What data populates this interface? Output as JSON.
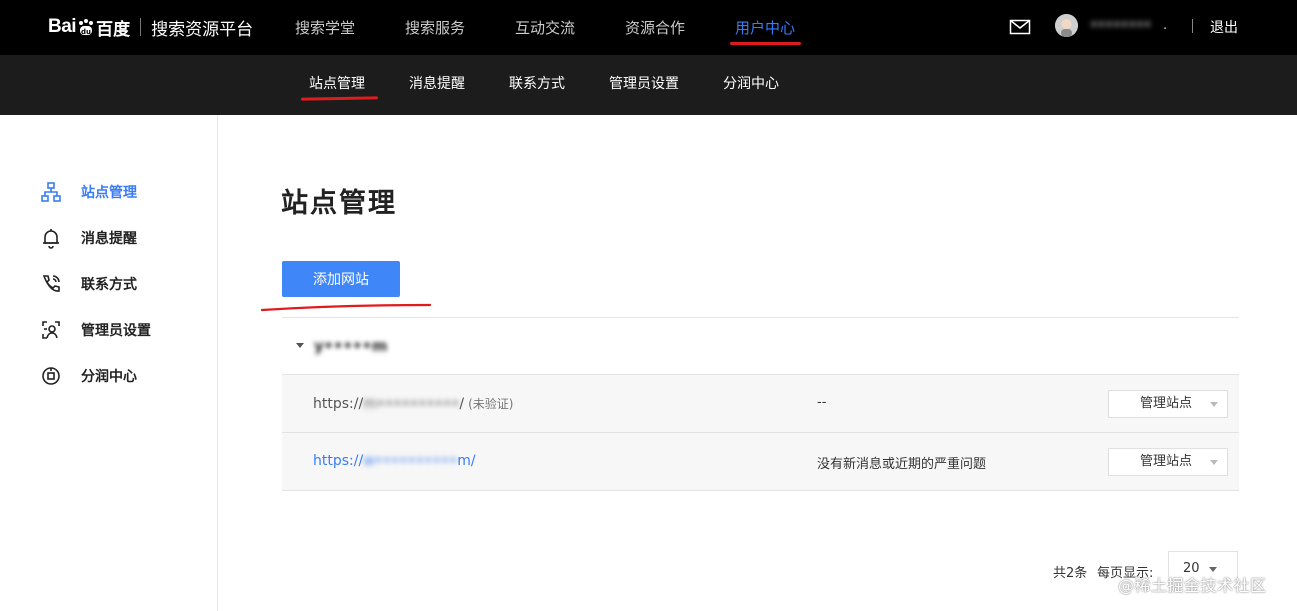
{
  "brand": {
    "logo_left": "Bai",
    "logo_right": "百度",
    "subtitle": "搜索资源平台"
  },
  "top_nav": [
    "搜索学堂",
    "搜索服务",
    "互动交流",
    "资源合作",
    "用户中心"
  ],
  "top_nav_active": "用户中心",
  "user": {
    "name": "••••••••",
    "dot": ".",
    "logout": "退出"
  },
  "sub_nav": [
    "站点管理",
    "消息提醒",
    "联系方式",
    "管理员设置",
    "分润中心"
  ],
  "sub_nav_active": "站点管理",
  "sidebar": {
    "items": [
      {
        "label": "站点管理",
        "icon": "sitemap-icon",
        "active": true
      },
      {
        "label": "消息提醒",
        "icon": "bell-icon",
        "active": false
      },
      {
        "label": "联系方式",
        "icon": "phone-icon",
        "active": false
      },
      {
        "label": "管理员设置",
        "icon": "admin-icon",
        "active": false
      },
      {
        "label": "分润中心",
        "icon": "share-icon",
        "active": false
      }
    ]
  },
  "main": {
    "title": "站点管理",
    "add_button": "添加网站",
    "group": {
      "name": "y•••••m"
    },
    "sites": [
      {
        "url_prefix": "https://",
        "url_hidden": "m••••••••••",
        "url_suffix": "/",
        "tag": "(未验证)",
        "message": "--",
        "action": "管理站点"
      },
      {
        "url_prefix": "https://",
        "url_hidden": "w••••••••••",
        "url_suffix": "m/",
        "tag": "",
        "message": "没有新消息或近期的严重问题",
        "action": "管理站点"
      }
    ]
  },
  "pagination": {
    "total": "共2条",
    "per_page_label": "每页显示:",
    "per_page": "20"
  },
  "watermark": "@稀土掘金技术社区",
  "colors": {
    "accent": "#3a7cf5",
    "button": "#3f87f8",
    "highlight_red": "#e01b1b",
    "topbar": "#000000",
    "subbar": "#1c1c1c"
  }
}
